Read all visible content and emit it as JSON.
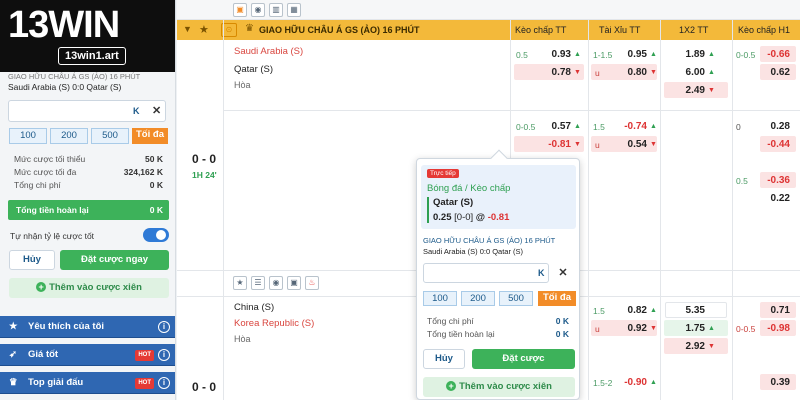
{
  "brand": {
    "logo": "13WIN",
    "url": "13win1.art"
  },
  "slip": {
    "league": "GIAO HỮU CHÂU Á GS (ẢO) 16 PHÚT",
    "match": "Saudi Arabia (S) 0:0 Qatar (S)",
    "input_suffix": "K",
    "amounts": [
      "100",
      "200",
      "500"
    ],
    "max_label": "Tối đa",
    "min_label": "Mức cược tối thiểu",
    "min_value": "50 K",
    "max_bet_label": "Mức cược tối đa",
    "max_bet_value": "324,162 K",
    "total_cost_label": "Tổng chi phí",
    "total_cost_value": "0 K",
    "refund_label": "Tổng tiền hoàn lại",
    "refund_value": "0 K",
    "auto_accept_label": "Tự nhận tỷ lệ cược tốt",
    "cancel": "Hủy",
    "place_now": "Đặt cược ngay",
    "add_parlay": "Thêm vào cược xiên"
  },
  "sidebar": [
    {
      "label": "Yêu thích của tôi",
      "hot": ""
    },
    {
      "label": "Giá tốt",
      "hot": "HOT"
    },
    {
      "label": "Top giải đấu",
      "hot": "HOT"
    }
  ],
  "grid": {
    "league_header": "GIAO HỮU CHÂU Á GS (ẢO) 16 PHÚT",
    "columns": [
      "Kèo chấp TT",
      "Tài Xỉu TT",
      "1X2 TT",
      "Kèo chấp H1"
    ],
    "match1": {
      "home": "Saudi Arabia (S)",
      "away": "Qatar (S)",
      "draw": "Hòa",
      "score": "0 - 0",
      "time": "1H 24'",
      "r1": {
        "hcap_line": "0.5",
        "hcap_odd": "0.93",
        "ou_line": "1-1.5",
        "ou_odd": "0.95",
        "x12": "1.89",
        "h1_line": "0-0.5",
        "h1_odd": "-0.66"
      },
      "r2": {
        "hcap_odd": "0.78",
        "ou_line": "u",
        "ou_odd": "0.80",
        "x12": "6.00",
        "h1_odd": "0.62"
      },
      "r3": {
        "x12": "2.49"
      },
      "r4": {
        "hcap_line": "0-0.5",
        "hcap_odd": "0.57",
        "ou_line": "1.5",
        "ou_odd": "-0.74",
        "h1_line": "0",
        "h1_odd": "0.28"
      },
      "r5": {
        "hcap_odd": "-0.81",
        "ou_line": "u",
        "ou_odd": "0.54",
        "h1_odd": "-0.44"
      },
      "r6": {
        "h1_line": "0.5",
        "h1_odd": "-0.36"
      },
      "r7": {
        "h1_odd": "0.22"
      }
    },
    "match2": {
      "home": "China (S)",
      "away": "Korea Republic (S)",
      "draw": "Hòa",
      "score": "0 - 0",
      "r1": {
        "ou_line": "1.5",
        "ou_odd": "0.82",
        "x12": "5.35",
        "h1_odd": "0.71"
      },
      "r2": {
        "ou_line": "u",
        "ou_odd": "0.92",
        "x12": "1.75",
        "h1_line": "0-0.5",
        "h1_odd": "-0.98"
      },
      "r3": {
        "x12": "2.92"
      },
      "r4": {
        "ou_line": "1.5-2",
        "ou_odd": "-0.90",
        "h1_odd": "0.39"
      }
    }
  },
  "popup": {
    "live_badge": "Trực tiếp",
    "market": "Bóng đá / Kèo chấp",
    "selection": "Qatar (S)",
    "line": "0.25",
    "score_tag": "[0-0]",
    "at": "@",
    "odd": "-0.81",
    "league": "GIAO HỮU CHÂU Á GS (ẢO) 16 PHÚT",
    "match": "Saudi Arabia (S) 0:0 Qatar (S)",
    "input_suffix": "K",
    "amounts": [
      "100",
      "200",
      "500"
    ],
    "max_label": "Tối đa",
    "total_cost_label": "Tổng chi phí",
    "total_cost_value": "0 K",
    "refund_label": "Tổng tiền hoàn lại",
    "refund_value": "0 K",
    "cancel": "Hủy",
    "place": "Đặt cược",
    "add_parlay": "Thêm vào cược xiên"
  }
}
